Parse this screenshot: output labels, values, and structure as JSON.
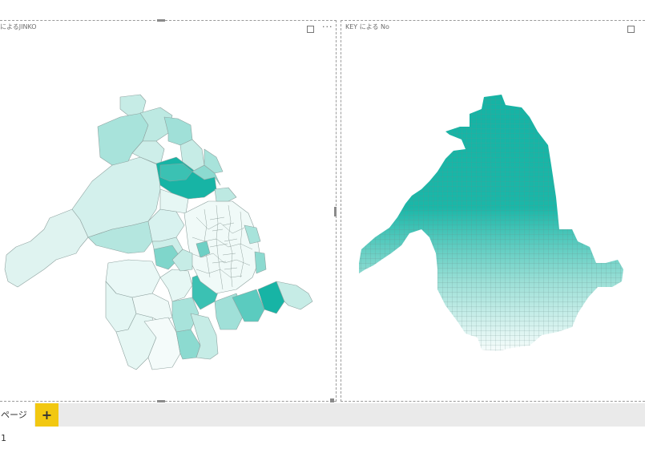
{
  "visuals": {
    "left": {
      "title": "によるJINKO"
    },
    "right": {
      "title": "KEY による No"
    }
  },
  "pages": {
    "tabs": [
      {
        "label": "ページ 1"
      }
    ],
    "add_label": "+"
  },
  "colors": {
    "accent": "#1ab8a8",
    "dark_teal": "#14b3a4",
    "light_teal": "#e8f8f5",
    "add_page_yellow": "#f2c811",
    "border_gray": "#9a9a9a",
    "pagebar_bg": "#eaeaea"
  },
  "icons": {
    "focus_mode": "focus-mode-icon",
    "more_options": "more-options-icon",
    "add_page": "plus-icon"
  }
}
